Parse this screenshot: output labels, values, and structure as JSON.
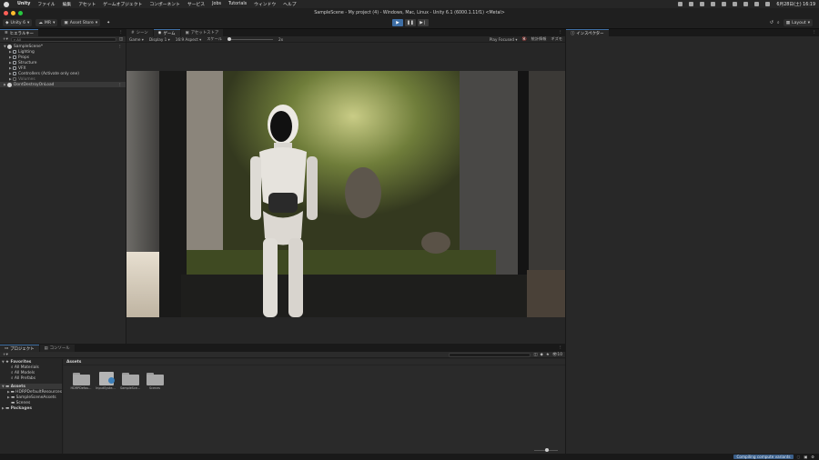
{
  "menubar": {
    "app": "Unity",
    "items": [
      "ファイル",
      "編集",
      "アセット",
      "ゲームオブジェクト",
      "コンポーネント",
      "サービス",
      "Jobs",
      "Tutorials",
      "ウィンドウ",
      "ヘルプ"
    ],
    "clock": "6月28日(土) 16:19"
  },
  "window": {
    "title": "SampleScene - My project (4) - Windows, Mac, Linux - Unity 6.1 (6000.1.11f1) <Metal>"
  },
  "toolbar": {
    "account": "Unity 6",
    "branch": "MR",
    "asset_store": "Asset Store",
    "layout": "Layout"
  },
  "hierarchy": {
    "tab": "ヒエラルキー",
    "search_label": "All",
    "items": [
      {
        "label": "SampleScene*",
        "depth": 0,
        "kind": "scene"
      },
      {
        "label": "Lighting",
        "depth": 1,
        "kind": "object"
      },
      {
        "label": "Props",
        "depth": 1,
        "kind": "object"
      },
      {
        "label": "Structure",
        "depth": 1,
        "kind": "object"
      },
      {
        "label": "VFX",
        "depth": 1,
        "kind": "object"
      },
      {
        "label": "Controllers (Activate only one)",
        "depth": 1,
        "kind": "object"
      },
      {
        "label": "Volumes",
        "depth": 1,
        "kind": "dim"
      },
      {
        "label": "DontDestroyOnLoad",
        "depth": 0,
        "kind": "scene"
      }
    ]
  },
  "game_view": {
    "tabs": [
      "シーン",
      "ゲーム",
      "アセットストア"
    ],
    "active_tab": 1,
    "display": "Display 1",
    "aspect": "16:9 Aspect",
    "scale_label": "スケール",
    "scale_value": "2x",
    "play_focused": "Play Focused",
    "stats": "統計情報",
    "gizmos": "ギズモ"
  },
  "inspector": {
    "tab": "インスペクター"
  },
  "project": {
    "tabs": [
      "プロジェクト",
      "コンソール"
    ],
    "favorites": {
      "label": "Favorites",
      "items": [
        "All Materials",
        "All Models",
        "All Prefabs"
      ]
    },
    "assets": {
      "label": "Assets",
      "items": [
        "HDRPDefaultResources",
        "SampleSceneAssets",
        "Scenes"
      ]
    },
    "packages": "Packages",
    "breadcrumb": "Assets",
    "grid": [
      {
        "label": "HDRPDefau...",
        "kind": "folder"
      },
      {
        "label": "InputSyste...",
        "kind": "book"
      },
      {
        "label": "SampleSce...",
        "kind": "folder"
      },
      {
        "label": "Scenes",
        "kind": "folder"
      }
    ],
    "count": "10"
  },
  "status": {
    "compile": "Compiling compute variants"
  }
}
